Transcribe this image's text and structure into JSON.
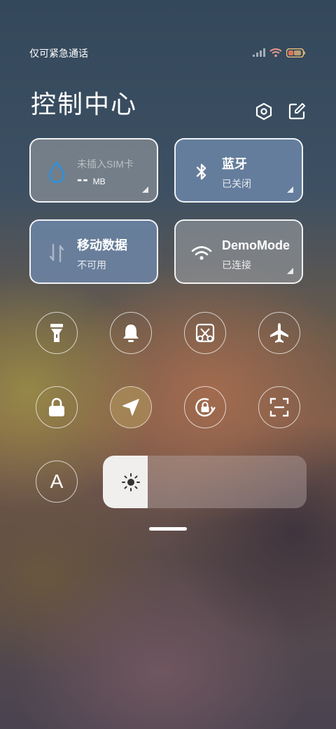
{
  "status_bar": {
    "carrier_text": "仅可紧急通话",
    "icons": [
      "signal-icon",
      "wifi-icon",
      "battery-icon"
    ]
  },
  "header": {
    "title": "控制中心",
    "buttons": [
      "settings-icon",
      "edit-icon"
    ]
  },
  "tiles": {
    "sim": {
      "label": "未插入SIM卡",
      "value": "--",
      "unit": "MB"
    },
    "bluetooth": {
      "label": "蓝牙",
      "status": "已关闭"
    },
    "mobile_data": {
      "label": "移动数据",
      "status": "不可用"
    },
    "wifi": {
      "label": "DemoMode",
      "status": "已连接"
    }
  },
  "toggles": {
    "row1": [
      "flashlight-icon",
      "bell-icon",
      "screenshot-icon",
      "airplane-icon"
    ],
    "row2": [
      "lock-icon",
      "location-icon",
      "rotation-lock-icon",
      "scan-icon"
    ],
    "location_on": true
  },
  "auto_brightness": {
    "label": "A"
  },
  "brightness": {
    "level": 0.22
  },
  "colors": {
    "accent_water": "#2e8fdc",
    "tile_blue": "#6e87aa",
    "tile_grey": "#969ba0",
    "slider_fill": "#f1efee"
  }
}
